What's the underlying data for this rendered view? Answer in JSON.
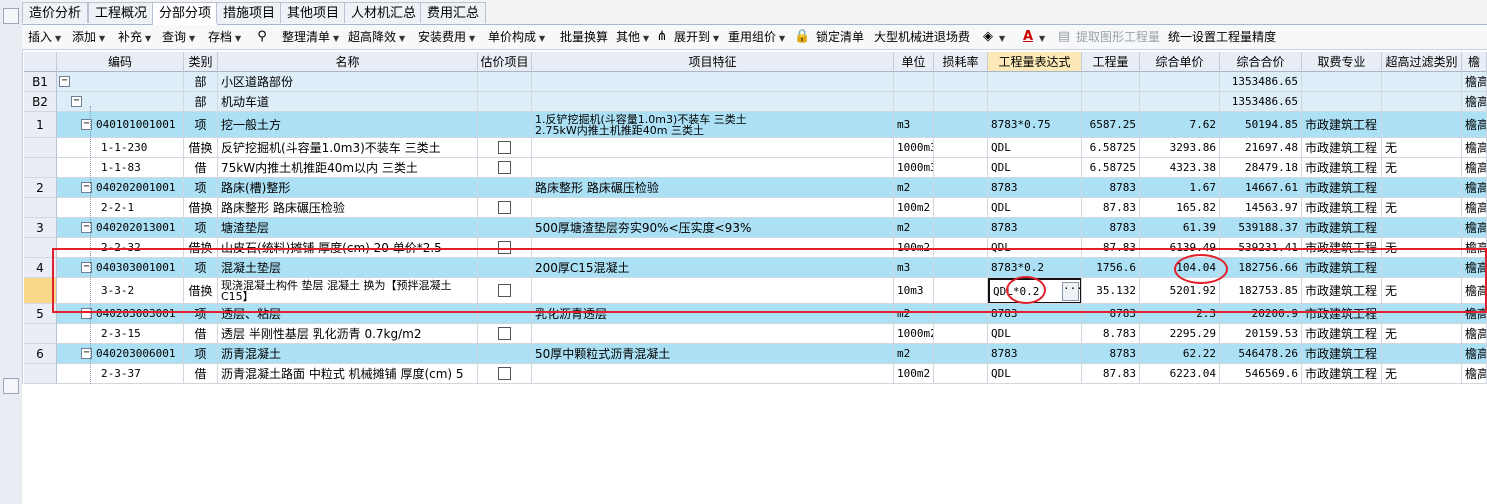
{
  "tabs": [
    "造价分析",
    "工程概况",
    "分部分项",
    "措施项目",
    "其他项目",
    "人材机汇总",
    "费用汇总"
  ],
  "active_tab": "分部分项",
  "toolbar": {
    "insert": "插入",
    "add": "添加",
    "supplement": "补充",
    "query": "查询",
    "store": "存档",
    "organize": "整理清单",
    "height_reduce": "超高降效",
    "install_fee": "安装费用",
    "unit_price": "单价构成",
    "batch": "批量换算",
    "other": "其他",
    "expand": "展开到",
    "reuse": "重用组价",
    "lock": "锁定清单",
    "machinery": "大型机械进退场费",
    "extract": "提取图形工程量",
    "precision": "统一设置工程量精度"
  },
  "headers": {
    "code": "编码",
    "type": "类别",
    "name": "名称",
    "estimate": "估价项目",
    "feature": "项目特征",
    "unit": "单位",
    "loss": "损耗率",
    "expr": "工程量表达式",
    "qty": "工程量",
    "uprice": "综合单价",
    "total": "综合合价",
    "major": "取费专业",
    "filter": "超高过滤类别",
    "more": "檐"
  },
  "rows": [
    {
      "rn": "B1",
      "code": "",
      "type": "部",
      "name": "小区道路部份",
      "feature": "",
      "unit": "",
      "expr": "",
      "qty": "",
      "uprice": "",
      "total": "1353486.65",
      "major": "",
      "filter": "",
      "more": "檐高"
    },
    {
      "rn": "B2",
      "code": "",
      "type": "部",
      "name": "机动车道",
      "feature": "",
      "unit": "",
      "expr": "",
      "qty": "",
      "uprice": "",
      "total": "1353486.65",
      "major": "",
      "filter": "",
      "more": "檐高"
    },
    {
      "rn": "1",
      "code": "040101001001",
      "type": "项",
      "name": "挖一般土方",
      "feature": "1.反铲挖掘机(斗容量1.0m3)不装车 三类土\n2.75kW内推土机推距40m 三类土",
      "unit": "m3",
      "expr": "8783*0.75",
      "qty": "6587.25",
      "uprice": "7.62",
      "total": "50194.85",
      "major": "市政建筑工程",
      "filter": "",
      "more": "檐高"
    },
    {
      "rn": "",
      "code": "1-1-230",
      "type": "借换",
      "name": "反铲挖掘机(斗容量1.0m3)不装车 三类土",
      "feature": "",
      "unit": "1000m3",
      "expr": "QDL",
      "qty": "6.58725",
      "uprice": "3293.86",
      "total": "21697.48",
      "major": "市政建筑工程",
      "filter": "无",
      "more": "檐高"
    },
    {
      "rn": "",
      "code": "1-1-83",
      "type": "借",
      "name": "75kW内推土机推距40m以内 三类土",
      "feature": "",
      "unit": "1000m3",
      "expr": "QDL",
      "qty": "6.58725",
      "uprice": "4323.38",
      "total": "28479.18",
      "major": "市政建筑工程",
      "filter": "无",
      "more": "檐高"
    },
    {
      "rn": "2",
      "code": "040202001001",
      "type": "项",
      "name": "路床(槽)整形",
      "feature": "路床整形 路床碾压检验",
      "unit": "m2",
      "expr": "8783",
      "qty": "8783",
      "uprice": "1.67",
      "total": "14667.61",
      "major": "市政建筑工程",
      "filter": "",
      "more": "檐高"
    },
    {
      "rn": "",
      "code": "2-2-1",
      "type": "借换",
      "name": "路床整形 路床碾压检验",
      "feature": "",
      "unit": "100m2",
      "expr": "QDL",
      "qty": "87.83",
      "uprice": "165.82",
      "total": "14563.97",
      "major": "市政建筑工程",
      "filter": "无",
      "more": "檐高"
    },
    {
      "rn": "3",
      "code": "040202013001",
      "type": "项",
      "name": "塘渣垫层",
      "feature": "500厚塘渣垫层夯实90%<压实度<93%",
      "unit": "m2",
      "expr": "8783",
      "qty": "8783",
      "uprice": "61.39",
      "total": "539188.37",
      "major": "市政建筑工程",
      "filter": "",
      "more": "檐高"
    },
    {
      "rn": "",
      "code": "2-2-32",
      "type": "借换",
      "name": "山皮石(统料)摊铺 厚度(cm) 20 单价*2.5",
      "feature": "",
      "unit": "100m2",
      "expr": "QDL",
      "qty": "87.83",
      "uprice": "6139.49",
      "total": "539231.41",
      "major": "市政建筑工程",
      "filter": "无",
      "more": "檐高"
    },
    {
      "rn": "4",
      "code": "040303001001",
      "type": "项",
      "name": "混凝土垫层",
      "feature": "200厚C15混凝土",
      "unit": "m3",
      "expr": "8783*0.2",
      "qty": "1756.6",
      "uprice": "104.04",
      "total": "182756.66",
      "major": "市政建筑工程",
      "filter": "",
      "more": "檐高"
    },
    {
      "rn": "",
      "code": "3-3-2",
      "type": "借换",
      "name": "现浇混凝土构件 垫层 混凝土  换为【预拌混凝土 C15】",
      "feature": "",
      "unit": "10m3",
      "expr": "QDL*0.2",
      "qty": "35.132",
      "uprice": "5201.92",
      "total": "182753.85",
      "major": "市政建筑工程",
      "filter": "无",
      "more": "檐高"
    },
    {
      "rn": "5",
      "code": "040203003001",
      "type": "项",
      "name": "透层、粘层",
      "feature": "乳化沥青透层",
      "unit": "m2",
      "expr": "8783",
      "qty": "8783",
      "uprice": "2.3",
      "total": "20200.9",
      "major": "市政建筑工程",
      "filter": "",
      "more": "檐高"
    },
    {
      "rn": "",
      "code": "2-3-15",
      "type": "借",
      "name": "透层 半刚性基层 乳化沥青 0.7kg/m2",
      "feature": "",
      "unit": "1000m2",
      "expr": "QDL",
      "qty": "8.783",
      "uprice": "2295.29",
      "total": "20159.53",
      "major": "市政建筑工程",
      "filter": "无",
      "more": "檐高"
    },
    {
      "rn": "6",
      "code": "040203006001",
      "type": "项",
      "name": "沥青混凝土",
      "feature": "50厚中颗粒式沥青混凝土",
      "unit": "m2",
      "expr": "8783",
      "qty": "8783",
      "uprice": "62.22",
      "total": "546478.26",
      "major": "市政建筑工程",
      "filter": "",
      "more": "檐高"
    },
    {
      "rn": "",
      "code": "2-3-37",
      "type": "借",
      "name": "沥青混凝土路面 中粒式 机械摊铺 厚度(cm) 5",
      "feature": "",
      "unit": "100m2",
      "expr": "QDL",
      "qty": "87.83",
      "uprice": "6223.04",
      "total": "546569.6",
      "major": "市政建筑工程",
      "filter": "无",
      "more": "檐高"
    }
  ],
  "colors": {
    "item_row": "#ace0f5",
    "header": "#e9eef6",
    "highlight_header": "#fde9b8",
    "annotation": "#e3202a"
  }
}
